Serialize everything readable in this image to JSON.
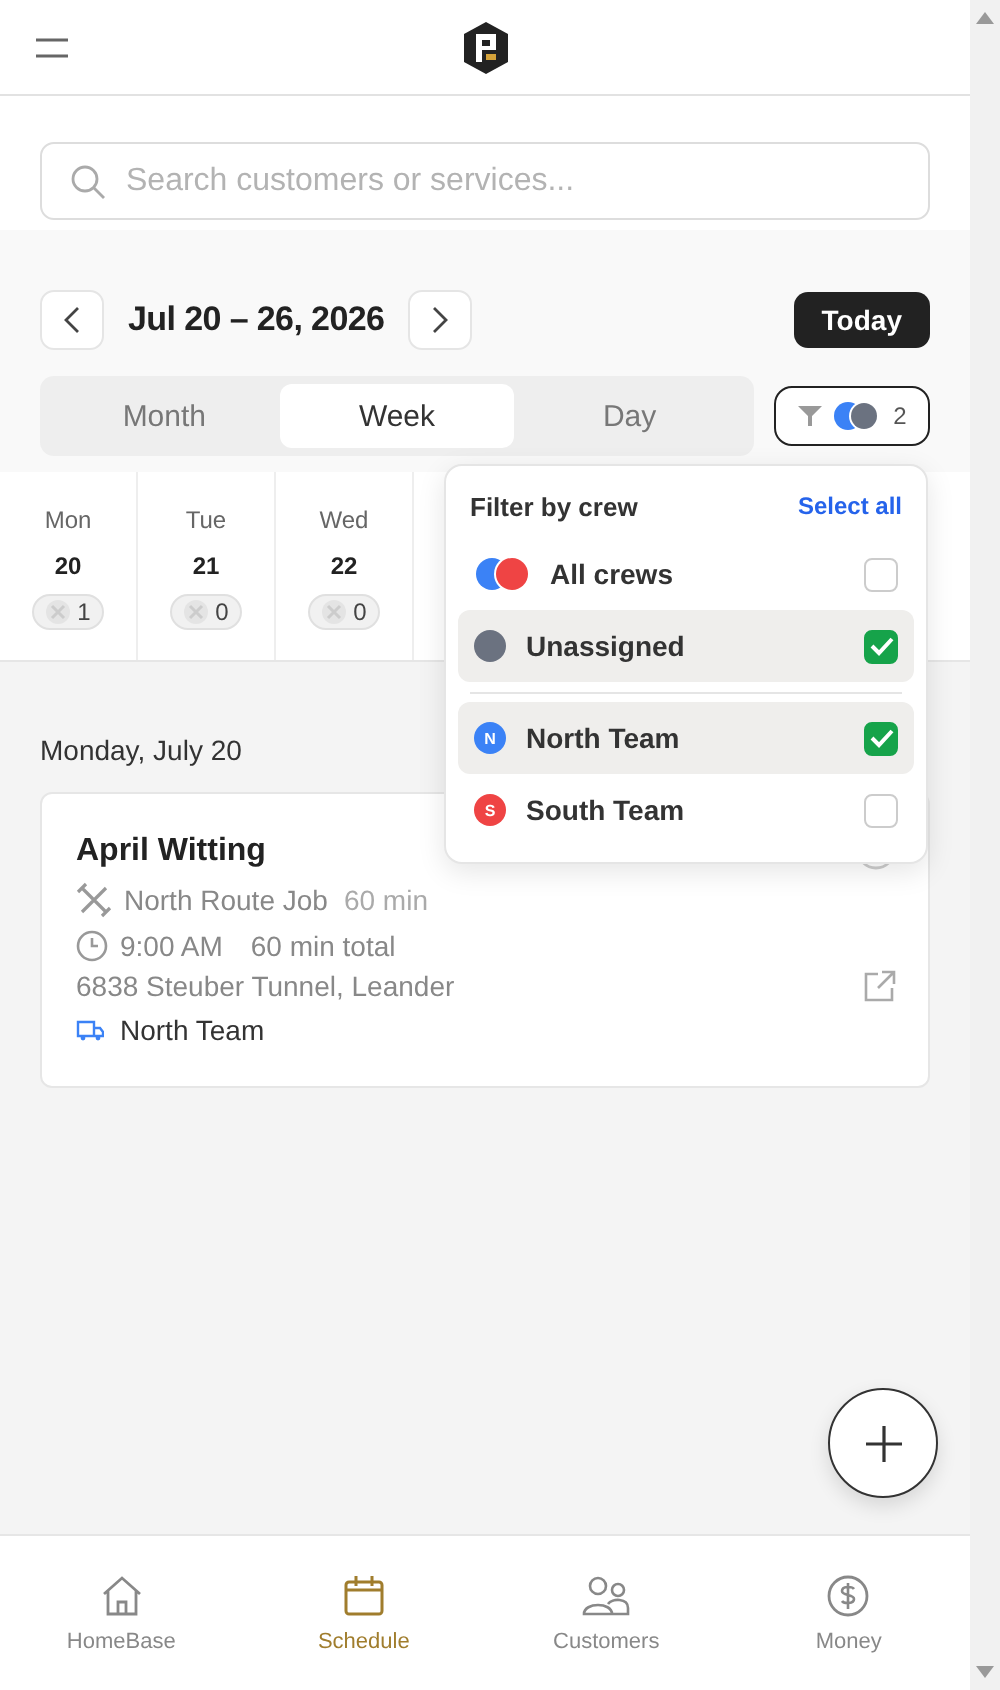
{
  "search": {
    "placeholder": "Search customers or services..."
  },
  "date_nav": {
    "title": "Jul 20 – 26, 2026",
    "today": "Today"
  },
  "view_tabs": [
    {
      "label": "Month",
      "selected": false
    },
    {
      "label": "Week",
      "selected": true
    },
    {
      "label": "Day",
      "selected": false
    }
  ],
  "filter_button": {
    "count": "2"
  },
  "days": [
    {
      "weekday": "Mon",
      "date": "20",
      "count": "1"
    },
    {
      "weekday": "Tue",
      "date": "21",
      "count": "0"
    },
    {
      "weekday": "Wed",
      "date": "22",
      "count": "0"
    }
  ],
  "crew_filter": {
    "title": "Filter by crew",
    "select_all": "Select all",
    "crews": [
      {
        "kind": "all",
        "name": "All crews",
        "checked": false
      },
      {
        "kind": "unassigned",
        "name": "Unassigned",
        "checked": true,
        "color": "#6b7280"
      },
      {
        "kind": "team",
        "name": "North Team",
        "initial": "N",
        "checked": true,
        "color": "#3b82f6"
      },
      {
        "kind": "team",
        "name": "South Team",
        "initial": "S",
        "checked": false,
        "color": "#ef4444"
      }
    ]
  },
  "day_heading": "Monday, July 20",
  "appointment": {
    "customer": "April Witting",
    "service": "North Route Job",
    "service_duration": "60 min",
    "time": "9:00 AM",
    "total": "60 min total",
    "address": "6838 Steuber Tunnel, Leander",
    "crew": "North Team"
  },
  "bottom_nav": [
    {
      "label": "HomeBase",
      "selected": false
    },
    {
      "label": "Schedule",
      "selected": true
    },
    {
      "label": "Customers",
      "selected": false
    },
    {
      "label": "Money",
      "selected": false
    }
  ]
}
